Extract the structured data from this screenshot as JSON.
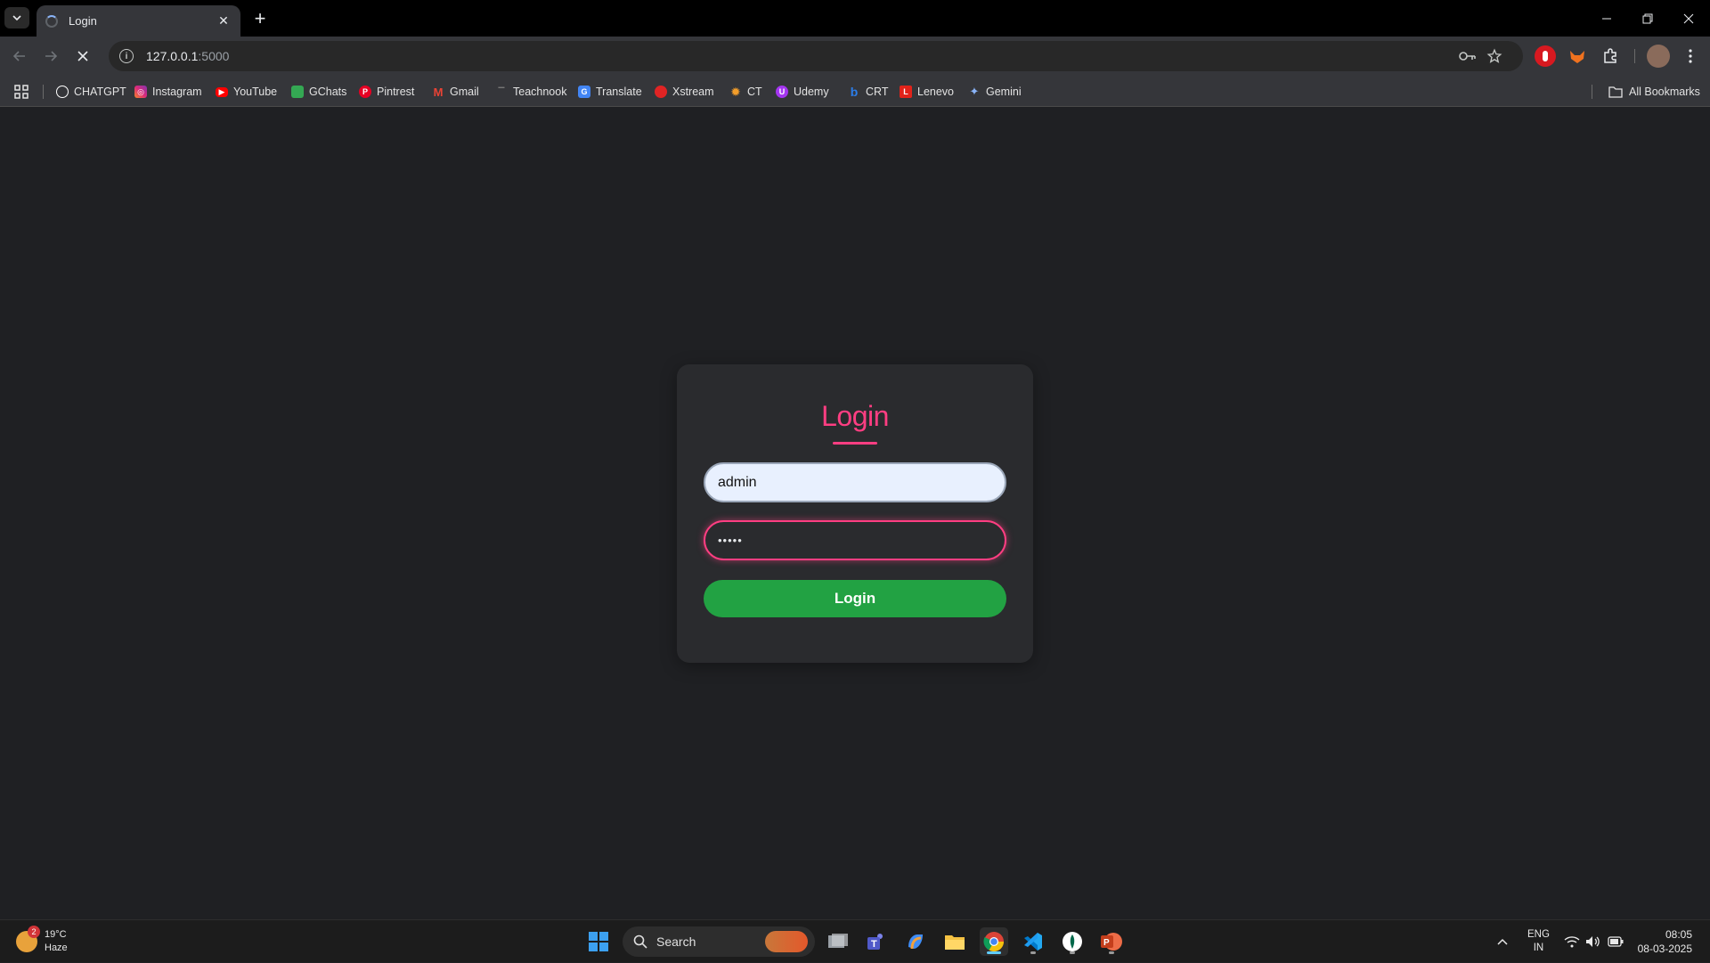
{
  "browser": {
    "tab_title": "Login",
    "url_host": "127.0.0.1",
    "url_port": ":5000"
  },
  "bookmarks": [
    {
      "label": "CHATGPT",
      "icon": "chatgpt-icon",
      "color": "#ffffff"
    },
    {
      "label": "Instagram",
      "icon": "instagram-icon",
      "color": "#e1306c"
    },
    {
      "label": "YouTube",
      "icon": "youtube-icon",
      "color": "#ff0000"
    },
    {
      "label": "GChats",
      "icon": "gchat-icon",
      "color": "#34a853"
    },
    {
      "label": "Pintrest",
      "icon": "pinterest-icon",
      "color": "#e60023"
    },
    {
      "label": "Gmail",
      "icon": "gmail-icon",
      "color": "#ea4335"
    },
    {
      "label": "Teachnook",
      "icon": "teachnook-icon",
      "color": "#555555"
    },
    {
      "label": "Translate",
      "icon": "translate-icon",
      "color": "#4285f4"
    },
    {
      "label": "Xstream",
      "icon": "xstream-icon",
      "color": "#e02424"
    },
    {
      "label": "CT",
      "icon": "ct-icon",
      "color": "#f29d2a"
    },
    {
      "label": "Udemy",
      "icon": "udemy-icon",
      "color": "#a435f0"
    },
    {
      "label": "CRT",
      "icon": "crt-icon",
      "color": "#2b7de9"
    },
    {
      "label": "Lenevo",
      "icon": "lenovo-icon",
      "color": "#e2231a"
    },
    {
      "label": "Gemini",
      "icon": "gemini-icon",
      "color": "#8ab4f8"
    }
  ],
  "all_bookmarks_label": "All Bookmarks",
  "login": {
    "heading": "Login",
    "username_value": "admin",
    "password_mask": "•••••",
    "button_label": "Login",
    "accent": "#ff3e82",
    "button_color": "#22a243"
  },
  "taskbar": {
    "weather_temp": "19°C",
    "weather_desc": "Haze",
    "weather_badge": "2",
    "search_label": "Search",
    "lang_top": "ENG",
    "lang_bottom": "IN",
    "time": "08:05",
    "date": "08-03-2025"
  }
}
